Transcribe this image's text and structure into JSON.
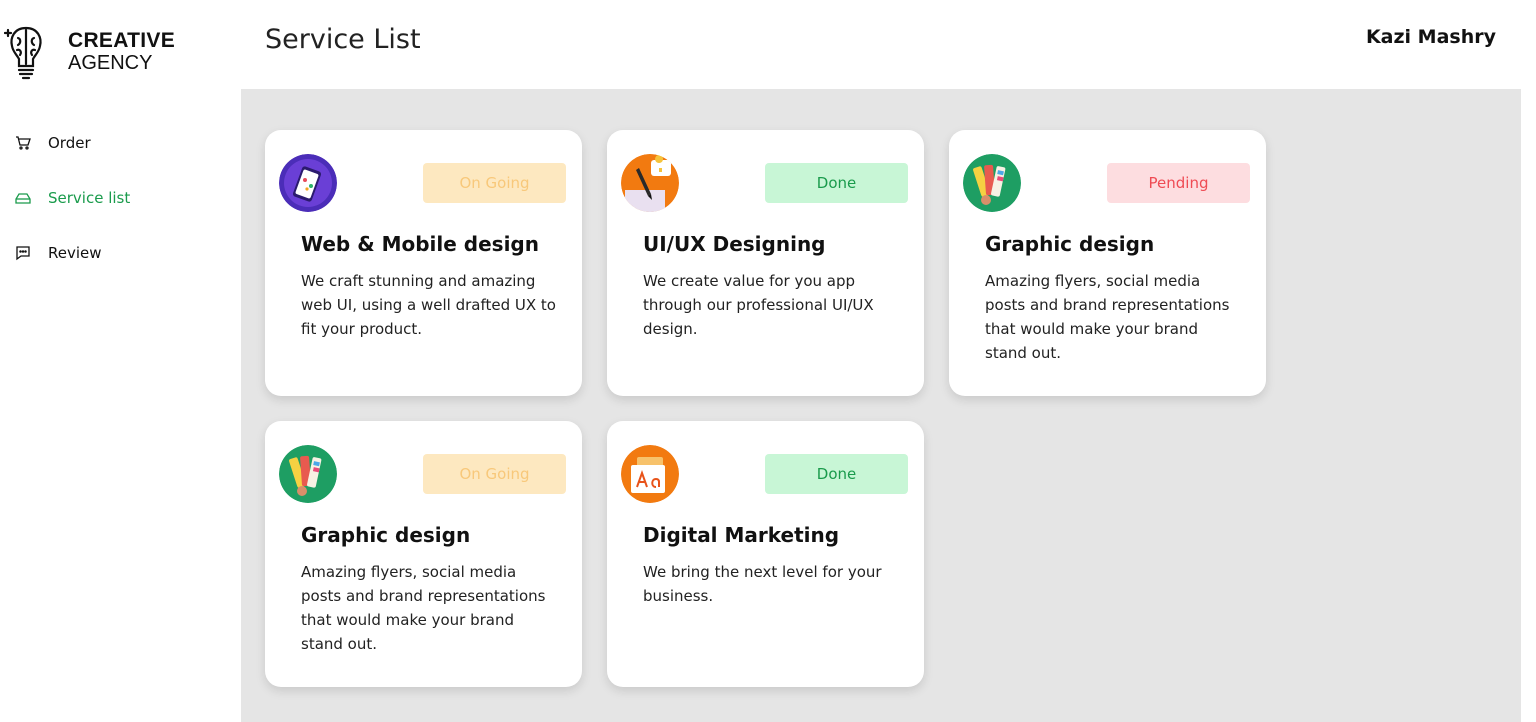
{
  "brand": {
    "title": "CREATIVE",
    "subtitle": "AGENCY"
  },
  "header": {
    "title": "Service List",
    "user": "Kazi Mashry"
  },
  "sidebar": {
    "items": [
      {
        "label": "Order",
        "icon": "cart-icon",
        "active": false
      },
      {
        "label": "Service list",
        "icon": "drive-icon",
        "active": true
      },
      {
        "label": "Review",
        "icon": "message-icon",
        "active": false
      }
    ]
  },
  "colors": {
    "accent": "#1a9b4c",
    "background": "#e5e5e5"
  },
  "cards": [
    {
      "icon": "phone-design-icon",
      "status": "On Going",
      "status_type": "ongoing",
      "title": "Web & Mobile design",
      "description": "We craft stunning and amazing web UI, using a well drafted UX to fit your product."
    },
    {
      "icon": "pen-bulb-icon",
      "status": "Done",
      "status_type": "done",
      "title": "UI/UX Designing",
      "description": "We create value for you app through our professional UI/UX design."
    },
    {
      "icon": "color-palette-icon",
      "status": "Pending",
      "status_type": "pending",
      "title": "Graphic design",
      "description": "Amazing flyers, social media posts and brand representations that would make your brand stand out."
    },
    {
      "icon": "color-palette-icon",
      "status": "On Going",
      "status_type": "ongoing",
      "title": "Graphic design",
      "description": "Amazing flyers, social media posts and brand representations that would make your brand stand out."
    },
    {
      "icon": "font-icon",
      "status": "Done",
      "status_type": "done",
      "title": "Digital Marketing",
      "description": "We bring the next level for your business."
    }
  ]
}
